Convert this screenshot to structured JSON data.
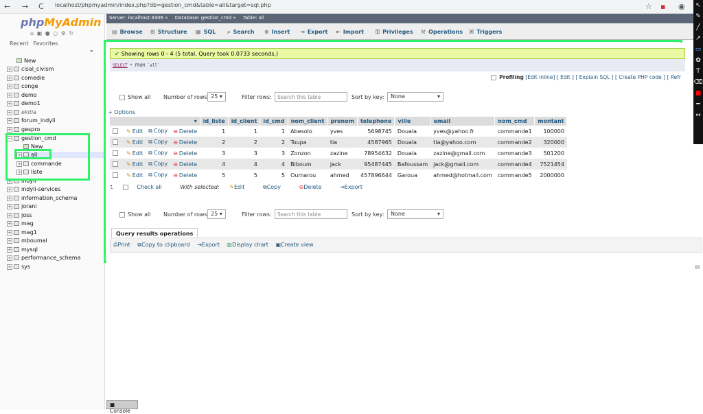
{
  "browser": {
    "back": "←",
    "forward": "→",
    "reload": "C",
    "url": "localhost/phpmyadmin/index.php?db=gestion_cmd&table=all&target=sql.php"
  },
  "nav": {
    "logo_a": "php",
    "logo_b": "MyAdmin",
    "tabs": [
      "Recent",
      "Favorites"
    ],
    "new": "New",
    "databases": [
      "cisal_civism",
      "comedie",
      "conge",
      "demo",
      "demo1",
      "ekitia",
      "forum_indyli",
      "gespro",
      "gestion_cmd",
      "New",
      "all",
      "commande",
      "liste",
      "indyli",
      "indyli-services",
      "information_schema",
      "jorani",
      "joss",
      "mag",
      "mag1",
      "mboumal",
      "mysql",
      "performance_schema",
      "sys"
    ]
  },
  "breadcrumbs": [
    "Server: localhost:3306 »",
    "Database: gestion_cmd »",
    "Table: all"
  ],
  "tabs": [
    "Browse",
    "Structure",
    "SQL",
    "Search",
    "Insert",
    "Export",
    "Import",
    "Privileges",
    "Operations",
    "Triggers"
  ],
  "result": {
    "success": "Showing rows 0 - 4 (5 total, Query took 0.0733 seconds.)",
    "sql_keyword": "SELECT",
    "sql_rest": " * FROM ",
    "sql_table": "`all`",
    "profiling_label": "Profiling",
    "profiling_links": "[Edit inline] [ Edit ] [ Explain SQL ] [ Create PHP code ] [ Refr"
  },
  "navbar": {
    "show_all": "Show all",
    "num_rows_label": "Number of rows:",
    "num_rows_value": "25",
    "filter_label": "Filter rows:",
    "filter_placeholder": "Search this table",
    "sort_label": "Sort by key:",
    "sort_value": "None"
  },
  "options_link": "+ Options",
  "table": {
    "columns": [
      "id_liste",
      "id_client",
      "id_cmd",
      "nom_client",
      "prenom",
      "telephone",
      "ville",
      "email",
      "nom_cmd",
      "montant"
    ],
    "actions": [
      "Edit",
      "Copy",
      "Delete"
    ],
    "rows": [
      [
        "1",
        "1",
        "1",
        "Abesolo",
        "yves",
        "5698745",
        "Douala",
        "yves@yahoo.fr",
        "commande1",
        "100000"
      ],
      [
        "2",
        "2",
        "2",
        "Toupa",
        "tia",
        "4587965",
        "Douala",
        "tia@yahoo.com",
        "commande2",
        "320000"
      ],
      [
        "3",
        "3",
        "3",
        "Zonzon",
        "zazine",
        "78954632",
        "Douala",
        "zazine@gmail.com",
        "commande3",
        "501200"
      ],
      [
        "4",
        "4",
        "4",
        "Biboum",
        "jack",
        "95487445",
        "Bafoussam",
        "jack@gmail.com",
        "commande4",
        "7521454"
      ],
      [
        "5",
        "5",
        "5",
        "Oumarou",
        "ahmed",
        "457896644",
        "Garoua",
        "ahmed@hotmail.com",
        "commande5",
        "2000000"
      ]
    ]
  },
  "with_selected": {
    "check_all": "Check all",
    "label": "With selected:",
    "edit": "Edit",
    "copy": "Copy",
    "delete": "Delete",
    "export": "Export"
  },
  "qro": {
    "title": "Query results operations",
    "print": "Print",
    "copy": "Copy to clipboard",
    "export": "Export",
    "chart": "Display chart",
    "view": "Create view"
  },
  "console": "Console",
  "accent": "#2ef26a"
}
